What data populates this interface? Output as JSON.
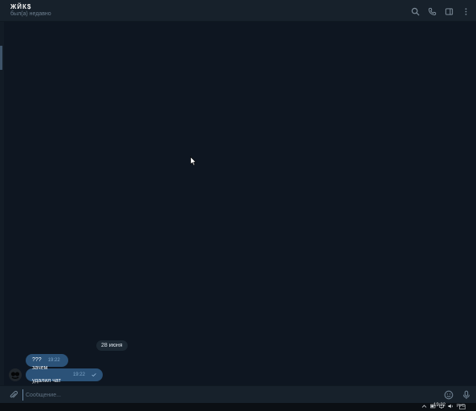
{
  "header": {
    "title": "ЖЙК$",
    "status": "был(а) недавно"
  },
  "messages": {
    "date_chip": "28 июня",
    "items": [
      {
        "text": "???",
        "time": "19:22"
      },
      {
        "text": "зачем удалил чат",
        "time": "19:22"
      }
    ]
  },
  "composer": {
    "placeholder": "Сообщение..."
  },
  "taskbar": {
    "lang": "РУС",
    "clock": "19:22"
  },
  "colors": {
    "background": "#0e1621",
    "panel": "#17212b",
    "bubble": "#2b5278",
    "accent": "#6b8aa6"
  },
  "icons": [
    "search-icon",
    "phone-icon",
    "sidebar-icon",
    "more-icon",
    "attach-icon",
    "emoji-icon",
    "mic-icon",
    "check-icon"
  ]
}
